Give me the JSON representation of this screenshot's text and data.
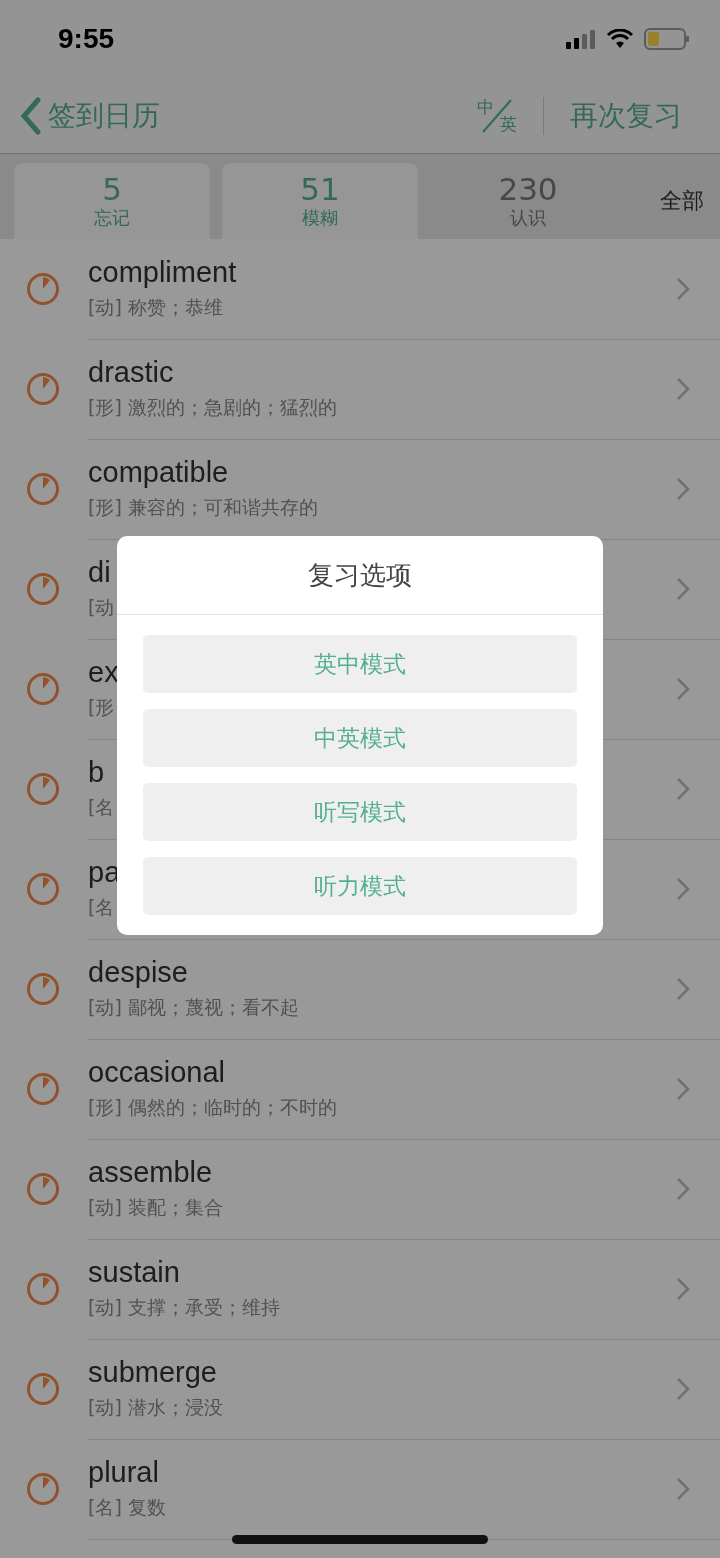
{
  "status_bar": {
    "time": "9:55"
  },
  "nav": {
    "back_label": "签到日历",
    "lang_top": "中",
    "lang_bottom": "英",
    "action": "再次复习"
  },
  "tabs": [
    {
      "count": "5",
      "label": "忘记",
      "selected": true
    },
    {
      "count": "51",
      "label": "模糊",
      "selected": true
    },
    {
      "count": "230",
      "label": "认识",
      "selected": false
    },
    {
      "label": "全部",
      "selected": false
    }
  ],
  "words": [
    {
      "word": "compliment",
      "meaning": "[动] 称赞；恭维"
    },
    {
      "word": "drastic",
      "meaning": "[形] 激烈的；急剧的；猛烈的"
    },
    {
      "word": "compatible",
      "meaning": "[形] 兼容的；可和谐共存的"
    },
    {
      "word": "di",
      "meaning": "[动"
    },
    {
      "word": "ex",
      "meaning": "[形"
    },
    {
      "word": "b",
      "meaning": "[名"
    },
    {
      "word": "pa",
      "meaning": "[名"
    },
    {
      "word": "despise",
      "meaning": "[动] 鄙视；蔑视；看不起"
    },
    {
      "word": "occasional",
      "meaning": "[形] 偶然的；临时的；不时的"
    },
    {
      "word": "assemble",
      "meaning": "[动] 装配；集合"
    },
    {
      "word": "sustain",
      "meaning": "[动] 支撑；承受；维持"
    },
    {
      "word": "submerge",
      "meaning": "[动] 潜水；浸没"
    },
    {
      "word": "plural",
      "meaning": "[名] 复数"
    }
  ],
  "dialog": {
    "title": "复习选项",
    "options": [
      "英中模式",
      "中英模式",
      "听写模式",
      "听力模式"
    ]
  }
}
